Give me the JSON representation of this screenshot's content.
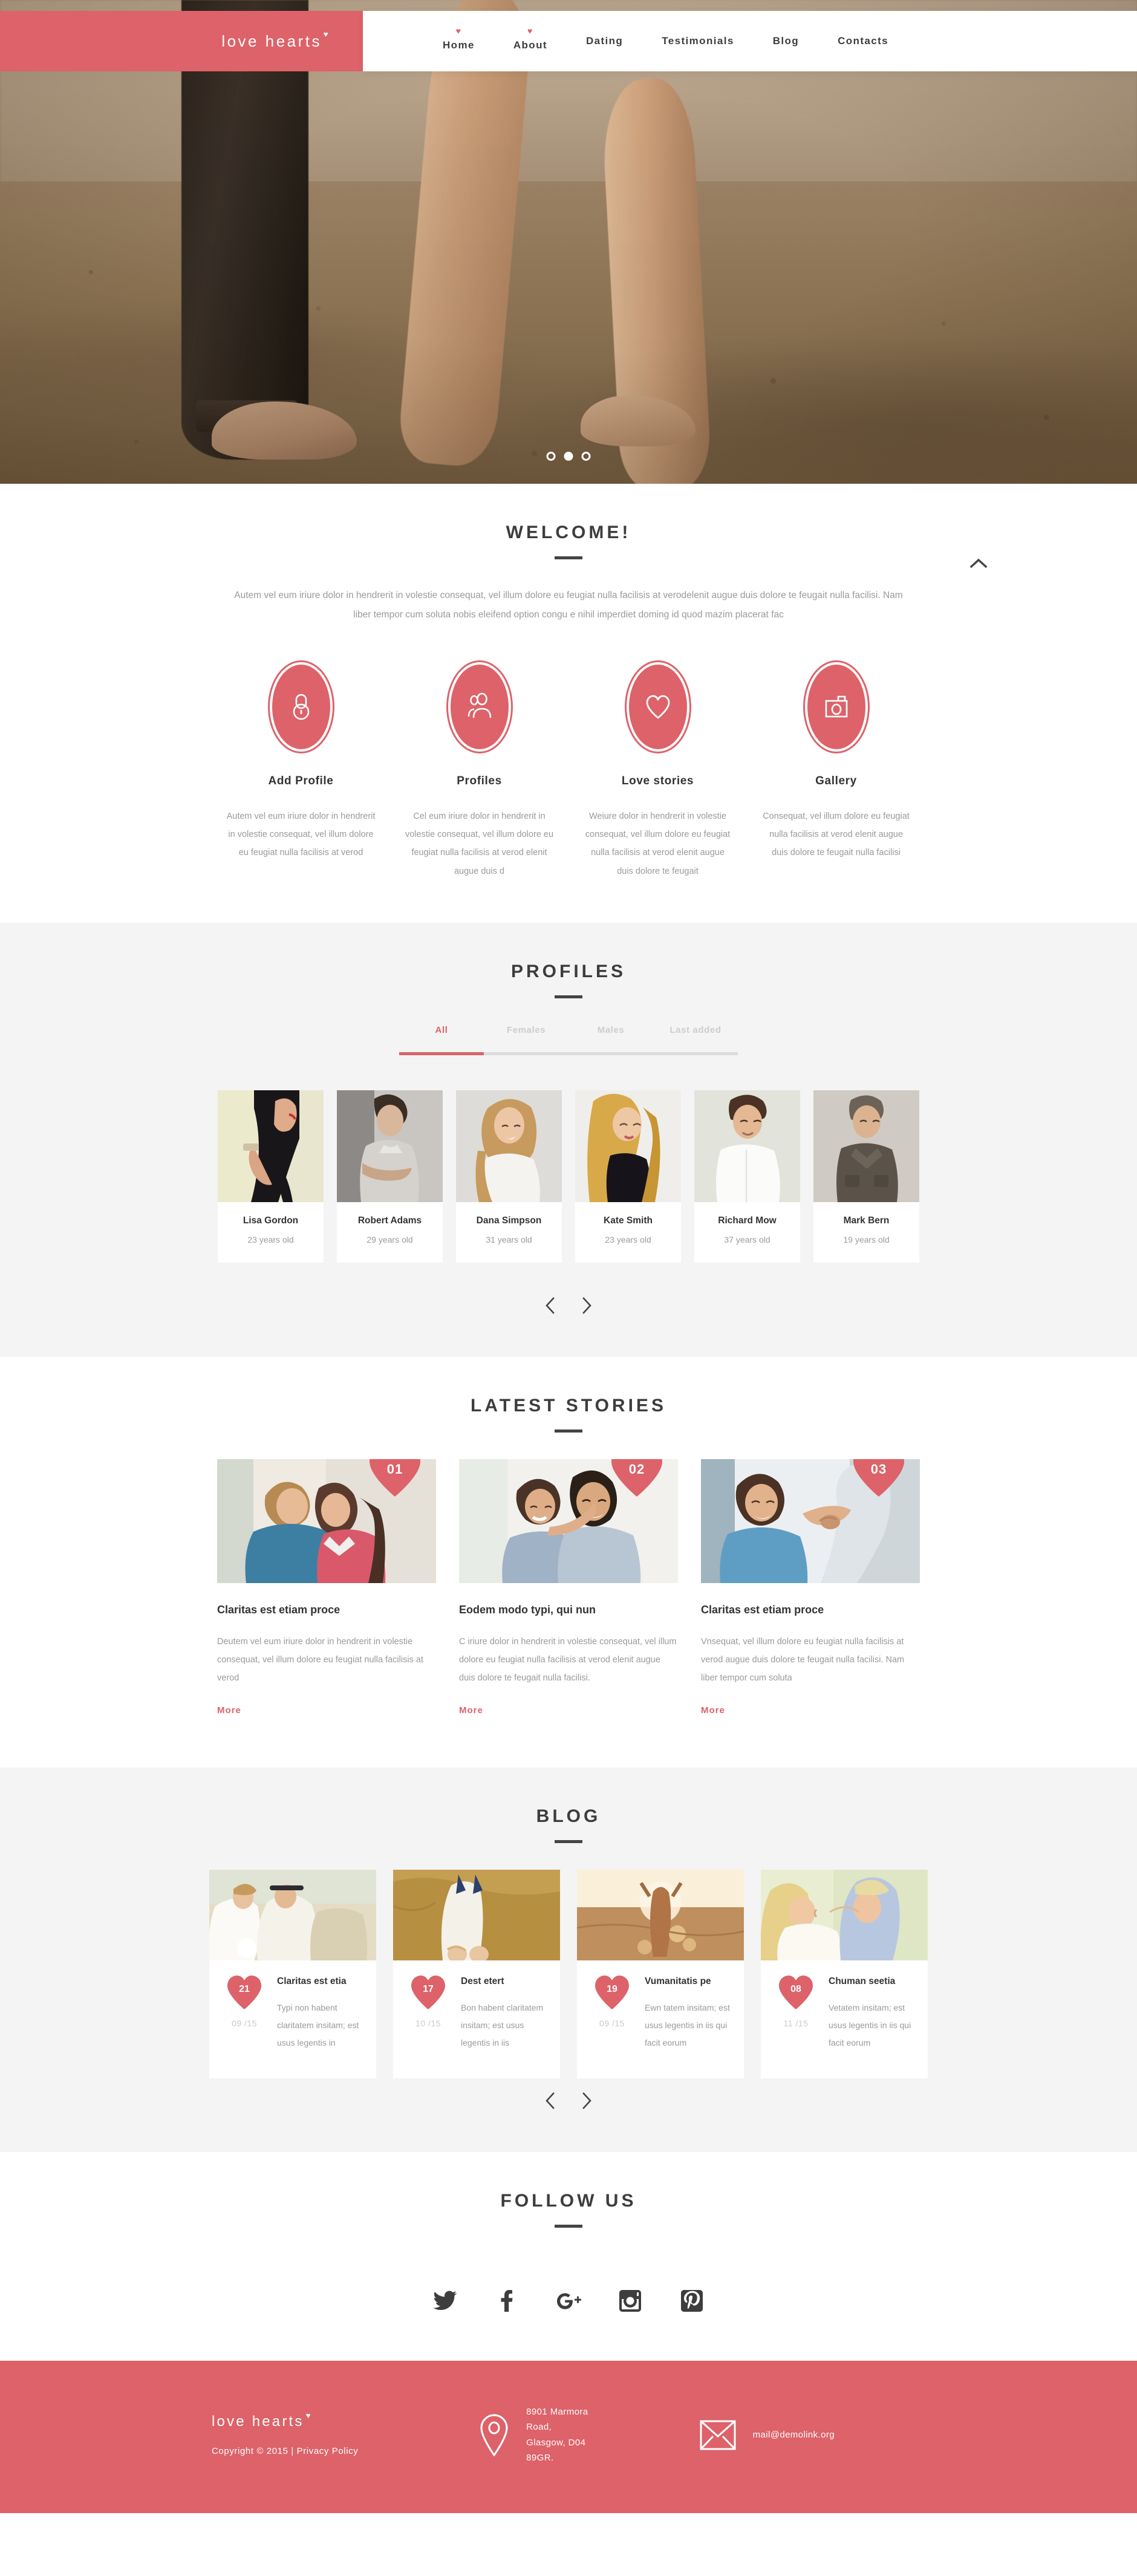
{
  "brand": {
    "name": "love hearts",
    "accent": "#dd6269",
    "text_dark": "#3d3d3d",
    "text_muted": "#9a9a9a",
    "section_bg": "#f4f4f4"
  },
  "nav": {
    "items": [
      {
        "label": "Home",
        "heart": true
      },
      {
        "label": "About",
        "heart": true
      },
      {
        "label": "Dating",
        "heart": false
      },
      {
        "label": "Testimonials",
        "heart": false
      },
      {
        "label": "Blog",
        "heart": false
      },
      {
        "label": "Contacts",
        "heart": false
      }
    ]
  },
  "hero": {
    "slides": 3,
    "active_slide": 2
  },
  "welcome": {
    "title": "WELCOME!",
    "paragraph": "Autem vel eum iriure dolor in hendrerit in volestie consequat, vel illum dolore eu feugiat nulla facilisis at verodelenit augue duis dolore te feugait nulla facilisi. Nam liber tempor cum soluta nobis eleifend option congu e nihil imperdiet doming id quod mazim placerat fac",
    "features": [
      {
        "icon": "lock-icon",
        "title": "Add Profile",
        "desc": "Autem vel eum iriure dolor in hendrerit in volestie consequat, vel illum dolore eu feugiat nulla facilisis at verod"
      },
      {
        "icon": "user-profile-icon",
        "title": "Profiles",
        "desc": "Cel eum iriure dolor in hendrerit in volestie consequat, vel illum dolore eu feugiat nulla facilisis at verod elenit augue duis d"
      },
      {
        "icon": "heart-icon",
        "title": "Love stories",
        "desc": "Weiure dolor in hendrerit in volestie consequat, vel illum dolore eu feugiat nulla facilisis at verod elenit augue duis dolore te feugait"
      },
      {
        "icon": "camera-icon",
        "title": "Gallery",
        "desc": "Consequat, vel illum dolore eu feugiat nulla facilisis at verod elenit augue duis dolore te feugait nulla facilisi"
      }
    ]
  },
  "profiles": {
    "title": "PROFILES",
    "filters": [
      {
        "label": "All",
        "active": true
      },
      {
        "label": "Females",
        "active": false
      },
      {
        "label": "Males",
        "active": false
      },
      {
        "label": "Last added",
        "active": false
      }
    ],
    "items": [
      {
        "name": "Lisa Gordon",
        "age": "23 years old"
      },
      {
        "name": "Robert Adams",
        "age": "29 years old"
      },
      {
        "name": "Dana Simpson",
        "age": "31 years old"
      },
      {
        "name": "Kate Smith",
        "age": "23 years old"
      },
      {
        "name": "Richard Mow",
        "age": "37 years old"
      },
      {
        "name": "Mark Bern",
        "age": "19 years old"
      }
    ],
    "prev_label": "prev",
    "next_label": "next"
  },
  "stories": {
    "title": "LATEST STORIES",
    "items": [
      {
        "number": "01",
        "title": "Claritas est etiam proce",
        "desc": "Deutem vel eum iriure dolor in hendrerit in volestie consequat, vel illum dolore eu feugiat nulla facilisis at verod",
        "more": "More"
      },
      {
        "number": "02",
        "title": "Eodem modo typi, qui nun",
        "desc": "C iriure dolor in hendrerit in volestie consequat, vel illum dolore eu feugiat nulla facilisis at verod elenit augue duis dolore te feugait nulla facilisi.",
        "more": "More"
      },
      {
        "number": "03",
        "title": "Claritas est etiam proce",
        "desc": "Vnsequat, vel illum dolore eu feugiat nulla facilisis at verod  augue duis dolore te feugait nulla facilisi. Nam liber tempor cum soluta",
        "more": "More"
      }
    ]
  },
  "blog": {
    "title": "BLOG",
    "items": [
      {
        "day": "21",
        "month": "09 /15",
        "title": "Claritas est etia",
        "excerpt": "Typi non habent claritatem insitam; est usus legentis in"
      },
      {
        "day": "17",
        "month": "10 /15",
        "title": "Dest etert",
        "excerpt": "Bon habent claritatem insitam; est usus legentis in iis"
      },
      {
        "day": "19",
        "month": "09 /15",
        "title": "Vumanitatis pe",
        "excerpt": "Ewn tatem insitam; est usus legentis in iis qui facit eorum"
      },
      {
        "day": "08",
        "month": "11 /15",
        "title": "Chuman seetia",
        "excerpt": "Vetatem insitam; est usus legentis in iis qui facit eorum"
      }
    ],
    "prev_label": "prev",
    "next_label": "next"
  },
  "follow": {
    "title": "FOLLOW US",
    "socials": [
      {
        "name": "twitter-icon"
      },
      {
        "name": "facebook-icon"
      },
      {
        "name": "google-plus-icon"
      },
      {
        "name": "instagram-icon"
      },
      {
        "name": "pinterest-icon"
      }
    ]
  },
  "footer": {
    "logo": "love hearts",
    "copyright": "Copyright © 2015 | Privacy Policy",
    "address_line1": "8901 Marmora Road,",
    "address_line2": "Glasgow, D04 89GR.",
    "email": "mail@demolink.org"
  }
}
